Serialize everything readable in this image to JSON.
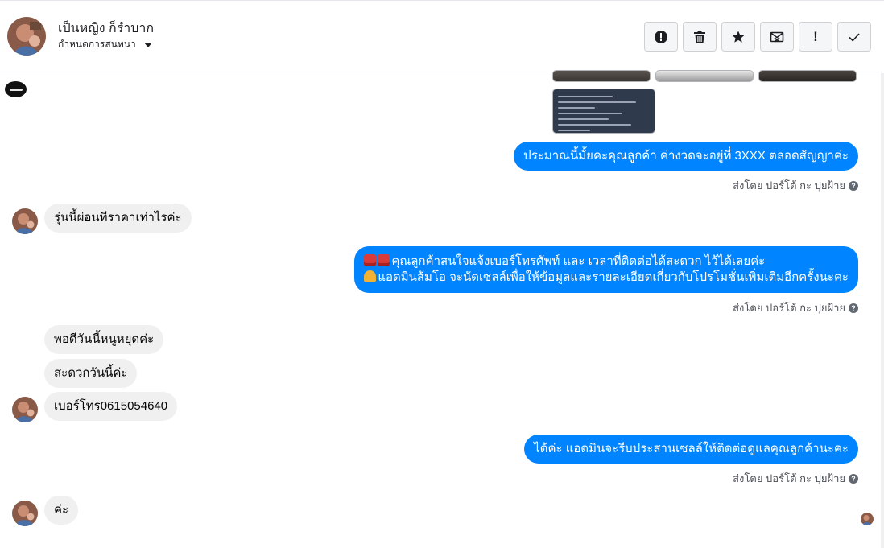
{
  "header": {
    "contact_name": "เป็นหญิง ก็รำบาก",
    "conversation_settings": "กำหนดการสนทนา"
  },
  "toolbar": {
    "buttons": [
      {
        "name": "report",
        "icon": "alert-circle-icon"
      },
      {
        "name": "delete",
        "icon": "trash-icon"
      },
      {
        "name": "star",
        "icon": "star-icon"
      },
      {
        "name": "mark-unread",
        "icon": "envelope-x-icon"
      },
      {
        "name": "important",
        "icon": "exclamation-icon",
        "glyph": "!"
      },
      {
        "name": "done",
        "icon": "check-icon"
      }
    ]
  },
  "messages": [
    {
      "id": "out1",
      "direction": "outgoing",
      "text": "ประมาณนี้มั้ยคะคุณลูกค้า ค่างวดจะอยู่ที่ 3XXX ตลอดสัญญาค่ะ",
      "sent_by": "ส่งโดย ปอร์โต้ กะ ปุยฝ้าย"
    },
    {
      "id": "in1",
      "direction": "incoming",
      "text": "รุ่นนี้ผ่อนทีราคาเท่าไรค่ะ"
    },
    {
      "id": "out2",
      "direction": "outgoing",
      "line1": "คุณลูกค้าสนใจแจ้งเบอร์โทรศัพท์ และ เวลาที่ติดต่อได้สะดวก ไว้ได้เลยค่ะ",
      "line2": "แอดมินส้มโอ จะนัดเซลล์เพื่อให้ข้อมูลและรายละเอียดเกี่ยวกับโปรโมชั่นเพิ่มเติมอีกครั้งนะคะ",
      "sent_by": "ส่งโดย ปอร์โต้ กะ ปุยฝ้าย"
    },
    {
      "id": "in2",
      "direction": "incoming",
      "text": "พอดีวันนี้หนูหยุดค่ะ"
    },
    {
      "id": "in3",
      "direction": "incoming",
      "text": "สะดวกวันนี้ค่ะ"
    },
    {
      "id": "in4",
      "direction": "incoming",
      "text": "เบอร์โทร0615054640"
    },
    {
      "id": "out3",
      "direction": "outgoing",
      "text": "ได้ค่ะ แอดมินจะรีบประสานเซลล์ให้ติดต่อดูแลคุณลูกค้านะคะ",
      "sent_by": "ส่งโดย ปอร์โต้ กะ ปุยฝ้าย"
    },
    {
      "id": "in5",
      "direction": "incoming",
      "text": "ค่ะ"
    }
  ],
  "help_glyph": "?",
  "colors": {
    "outgoing_bubble": "#0084ff",
    "incoming_bubble": "#f1f0f0"
  }
}
